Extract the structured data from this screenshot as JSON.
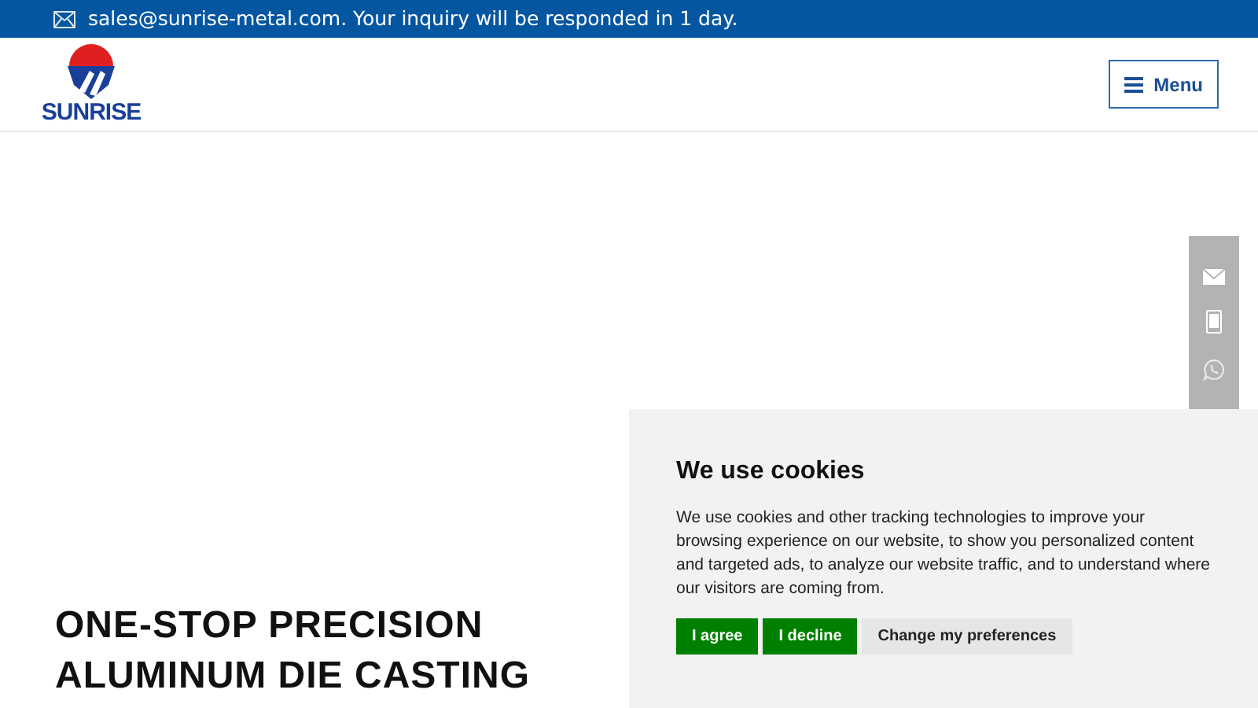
{
  "top_bar": {
    "text": "sales@sunrise-metal.com. Your inquiry will be responded in 1 day."
  },
  "header": {
    "logo_text": "SUNRISE",
    "menu_button": "Menu"
  },
  "hero": {
    "heading_lines": [
      "ONE-STOP PRECISION",
      "ALUMINUM DIE CASTING"
    ]
  },
  "cookie_banner": {
    "title": "We use cookies",
    "text": "We use cookies and other tracking technologies to improve your browsing experience on our website, to show you personalized content and targeted ads, to analyze our website traffic, and to understand where our visitors are coming from.",
    "buttons": [
      {
        "label": "I agree",
        "kind": "primary"
      },
      {
        "label": "I decline",
        "kind": "primary"
      },
      {
        "label": "Change my preferences",
        "kind": "secondary"
      }
    ]
  }
}
